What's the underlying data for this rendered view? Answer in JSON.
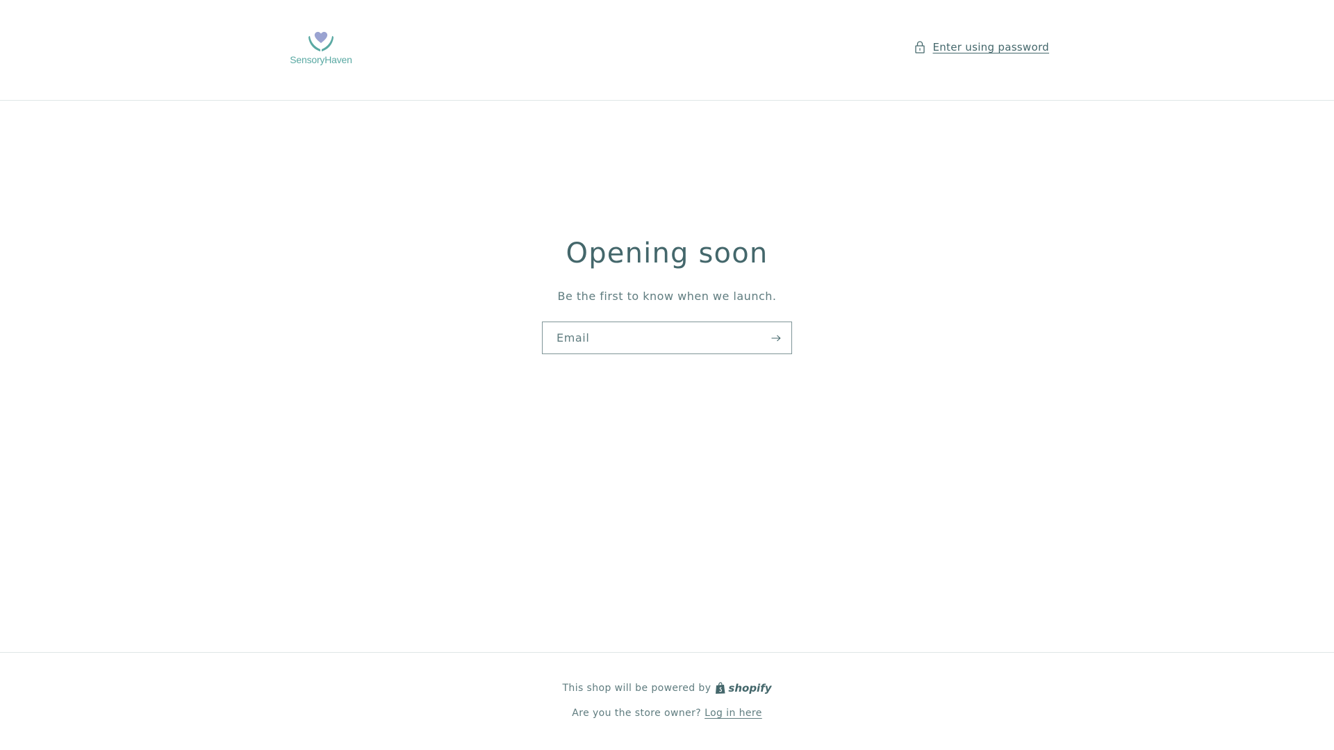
{
  "header": {
    "logo_text_first": "Sensory",
    "logo_text_second": "Haven",
    "password_link_label": "Enter using password",
    "password_icon": "lock-icon"
  },
  "main": {
    "title": "Opening soon",
    "subtitle": "Be the first to know when we launch.",
    "email_placeholder": "Email",
    "email_value": "",
    "submit_icon": "arrow-right-icon"
  },
  "footer": {
    "powered_text": "This shop will be powered by",
    "shopify_label": "shopify",
    "shopify_icon": "shopify-bag-icon",
    "owner_text": "Are you the store owner?",
    "login_label": "Log in here"
  },
  "colors": {
    "text": "#44676b",
    "muted": "#5f7c7f",
    "logo_teal": "#5aa9a3",
    "logo_heart": "#9aa3d1",
    "border": "#dfe6e6",
    "input_border": "#7e9497"
  }
}
